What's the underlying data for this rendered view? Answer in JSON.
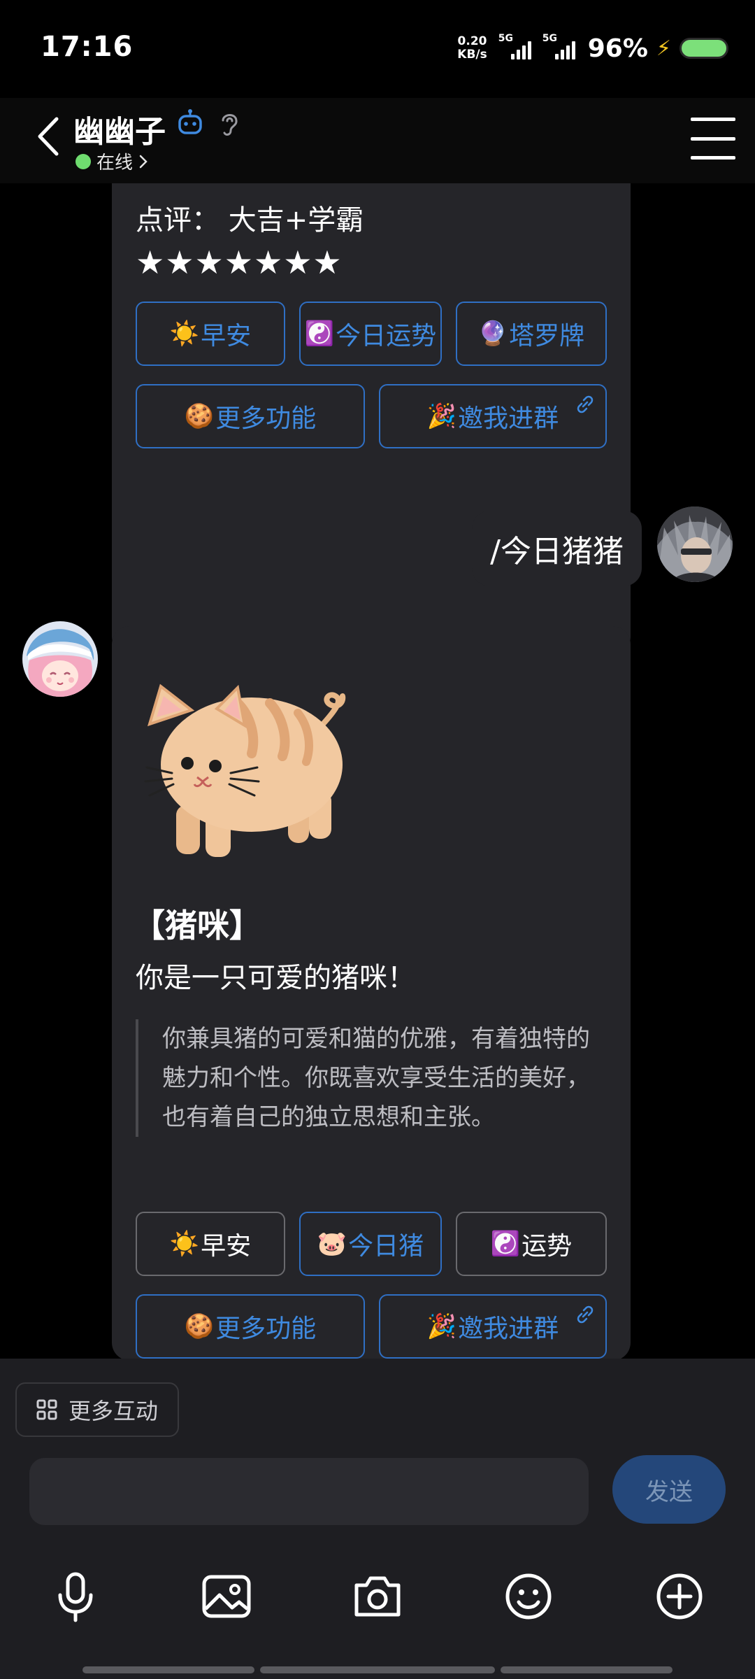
{
  "status_bar": {
    "time": "17:16",
    "net_speed_value": "0.20",
    "net_speed_unit": "KB/s",
    "signal1_label": "5G",
    "signal2_label": "5G",
    "battery": "96%"
  },
  "header": {
    "title": "幽幽子",
    "presence": "在线"
  },
  "chat": {
    "card1": {
      "review": "点评：  大吉+学霸",
      "stars": "★★★★★★★",
      "buttons": [
        {
          "emoji": "☀️",
          "label": "早安"
        },
        {
          "emoji": "☯️",
          "label": "今日运势"
        },
        {
          "emoji": "🔮",
          "label": "塔罗牌"
        },
        {
          "emoji": "🍪",
          "label": "更多功能"
        },
        {
          "emoji": "🎉",
          "label": "邀我进群"
        }
      ]
    },
    "user_message": "/今日猪猪",
    "card2": {
      "title": "【猪咪】",
      "subtitle": "你是一只可爱的猪咪！",
      "description": "你兼具猪的可爱和猫的优雅，有着独特的魅力和个性。你既喜欢享受生活的美好，也有着自己的独立思想和主张。",
      "buttons": [
        {
          "emoji": "☀️",
          "label": "早安"
        },
        {
          "emoji": "🐷",
          "label": "今日猪"
        },
        {
          "emoji": "☯️",
          "label": "运势"
        },
        {
          "emoji": "🍪",
          "label": "更多功能"
        },
        {
          "emoji": "🎉",
          "label": "邀我进群"
        }
      ]
    }
  },
  "bottom": {
    "more_interaction": "更多互动",
    "input_value": "",
    "send": "发送"
  },
  "icons": [
    "back-icon",
    "bot-icon",
    "ear-icon",
    "menu-icon",
    "grid-icon",
    "link-icon",
    "microphone-icon",
    "image-icon",
    "camera-icon",
    "emoji-icon",
    "plus-icon"
  ],
  "colors": {
    "background": "#000000",
    "card": "#252529",
    "accent_blue": "#3f8ae0",
    "online_green": "#6fdc6f",
    "send_button": "#24477a"
  }
}
